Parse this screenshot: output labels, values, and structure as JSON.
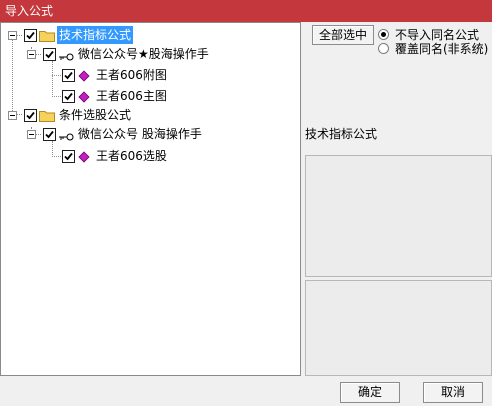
{
  "window": {
    "title": "导入公式"
  },
  "tree": {
    "groups": [
      {
        "label": "技术指标公式",
        "checked": true,
        "selected": true,
        "authors": [
          {
            "label": "微信公众号★股海操作手",
            "checked": true,
            "items": [
              {
                "label": "王者606附图",
                "checked": true
              },
              {
                "label": "王者606主图",
                "checked": true
              }
            ]
          }
        ]
      },
      {
        "label": "条件选股公式",
        "checked": true,
        "selected": false,
        "authors": [
          {
            "label": "微信公众号 股海操作手",
            "checked": true,
            "items": [
              {
                "label": "王者606选股",
                "checked": true
              }
            ]
          }
        ]
      }
    ]
  },
  "options": {
    "select_all_label": "全部选中",
    "radios": [
      {
        "label": "不导入同名公式",
        "selected": true
      },
      {
        "label": "覆盖同名(非系统)",
        "selected": false
      }
    ]
  },
  "info": {
    "title": "技术指标公式"
  },
  "footer": {
    "ok_label": "确定",
    "cancel_label": "取消"
  },
  "colors": {
    "titlebar": "#c4373c",
    "selection": "#3399ff",
    "gem": "#c020c0",
    "folder": "#f5d35a"
  }
}
